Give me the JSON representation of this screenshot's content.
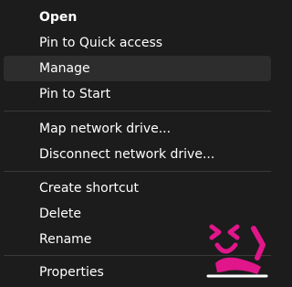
{
  "context_menu": {
    "items": [
      {
        "label": "Open",
        "bold": true
      },
      {
        "label": "Pin to Quick access"
      },
      {
        "label": "Manage",
        "hovered": true
      },
      {
        "label": "Pin to Start"
      },
      {
        "label": "Map network drive..."
      },
      {
        "label": "Disconnect network drive..."
      },
      {
        "label": "Create shortcut"
      },
      {
        "label": "Delete"
      },
      {
        "label": "Rename"
      },
      {
        "label": "Properties"
      }
    ]
  },
  "colors": {
    "background": "#1c1c1c",
    "hover": "#2d2d2d",
    "separator": "#3a3a3a",
    "text": "#ffffff",
    "watermark_pink": "#e0168a"
  },
  "watermark": {
    "icon": "cartoon-face-logo"
  }
}
